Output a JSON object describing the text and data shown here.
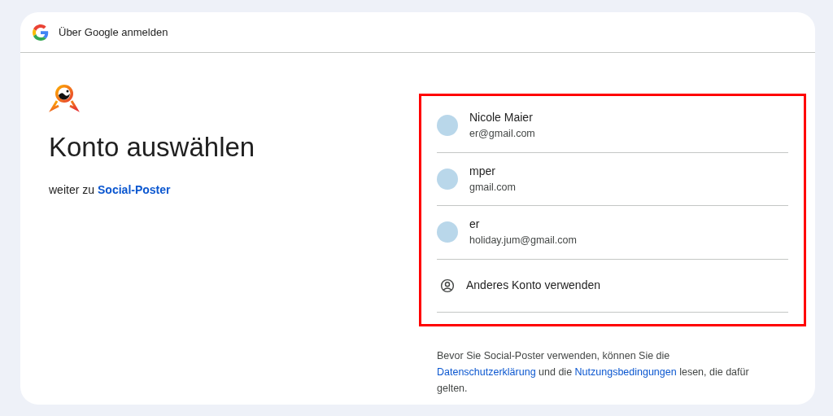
{
  "header": {
    "title": "Über Google anmelden"
  },
  "heading": "Konto auswählen",
  "subtitle": {
    "prefix": "weiter zu",
    "app": "Social-Poster"
  },
  "accounts": [
    {
      "kind": "account",
      "name": "Nicole Maier",
      "email": "er@gmail.com"
    },
    {
      "kind": "account",
      "name": "mper",
      "email": "gmail.com"
    },
    {
      "kind": "account",
      "name": "er",
      "email": "holiday.jum@gmail.com"
    },
    {
      "kind": "other",
      "name": "Anderes Konto verwenden"
    }
  ],
  "notice": {
    "before": "Bevor Sie Social-Poster verwenden, können Sie die",
    "privacy": "Datenschutzerklärung",
    "middle": "und die",
    "terms": "Nutzungsbedingungen",
    "after": "lesen, die dafür gelten."
  }
}
